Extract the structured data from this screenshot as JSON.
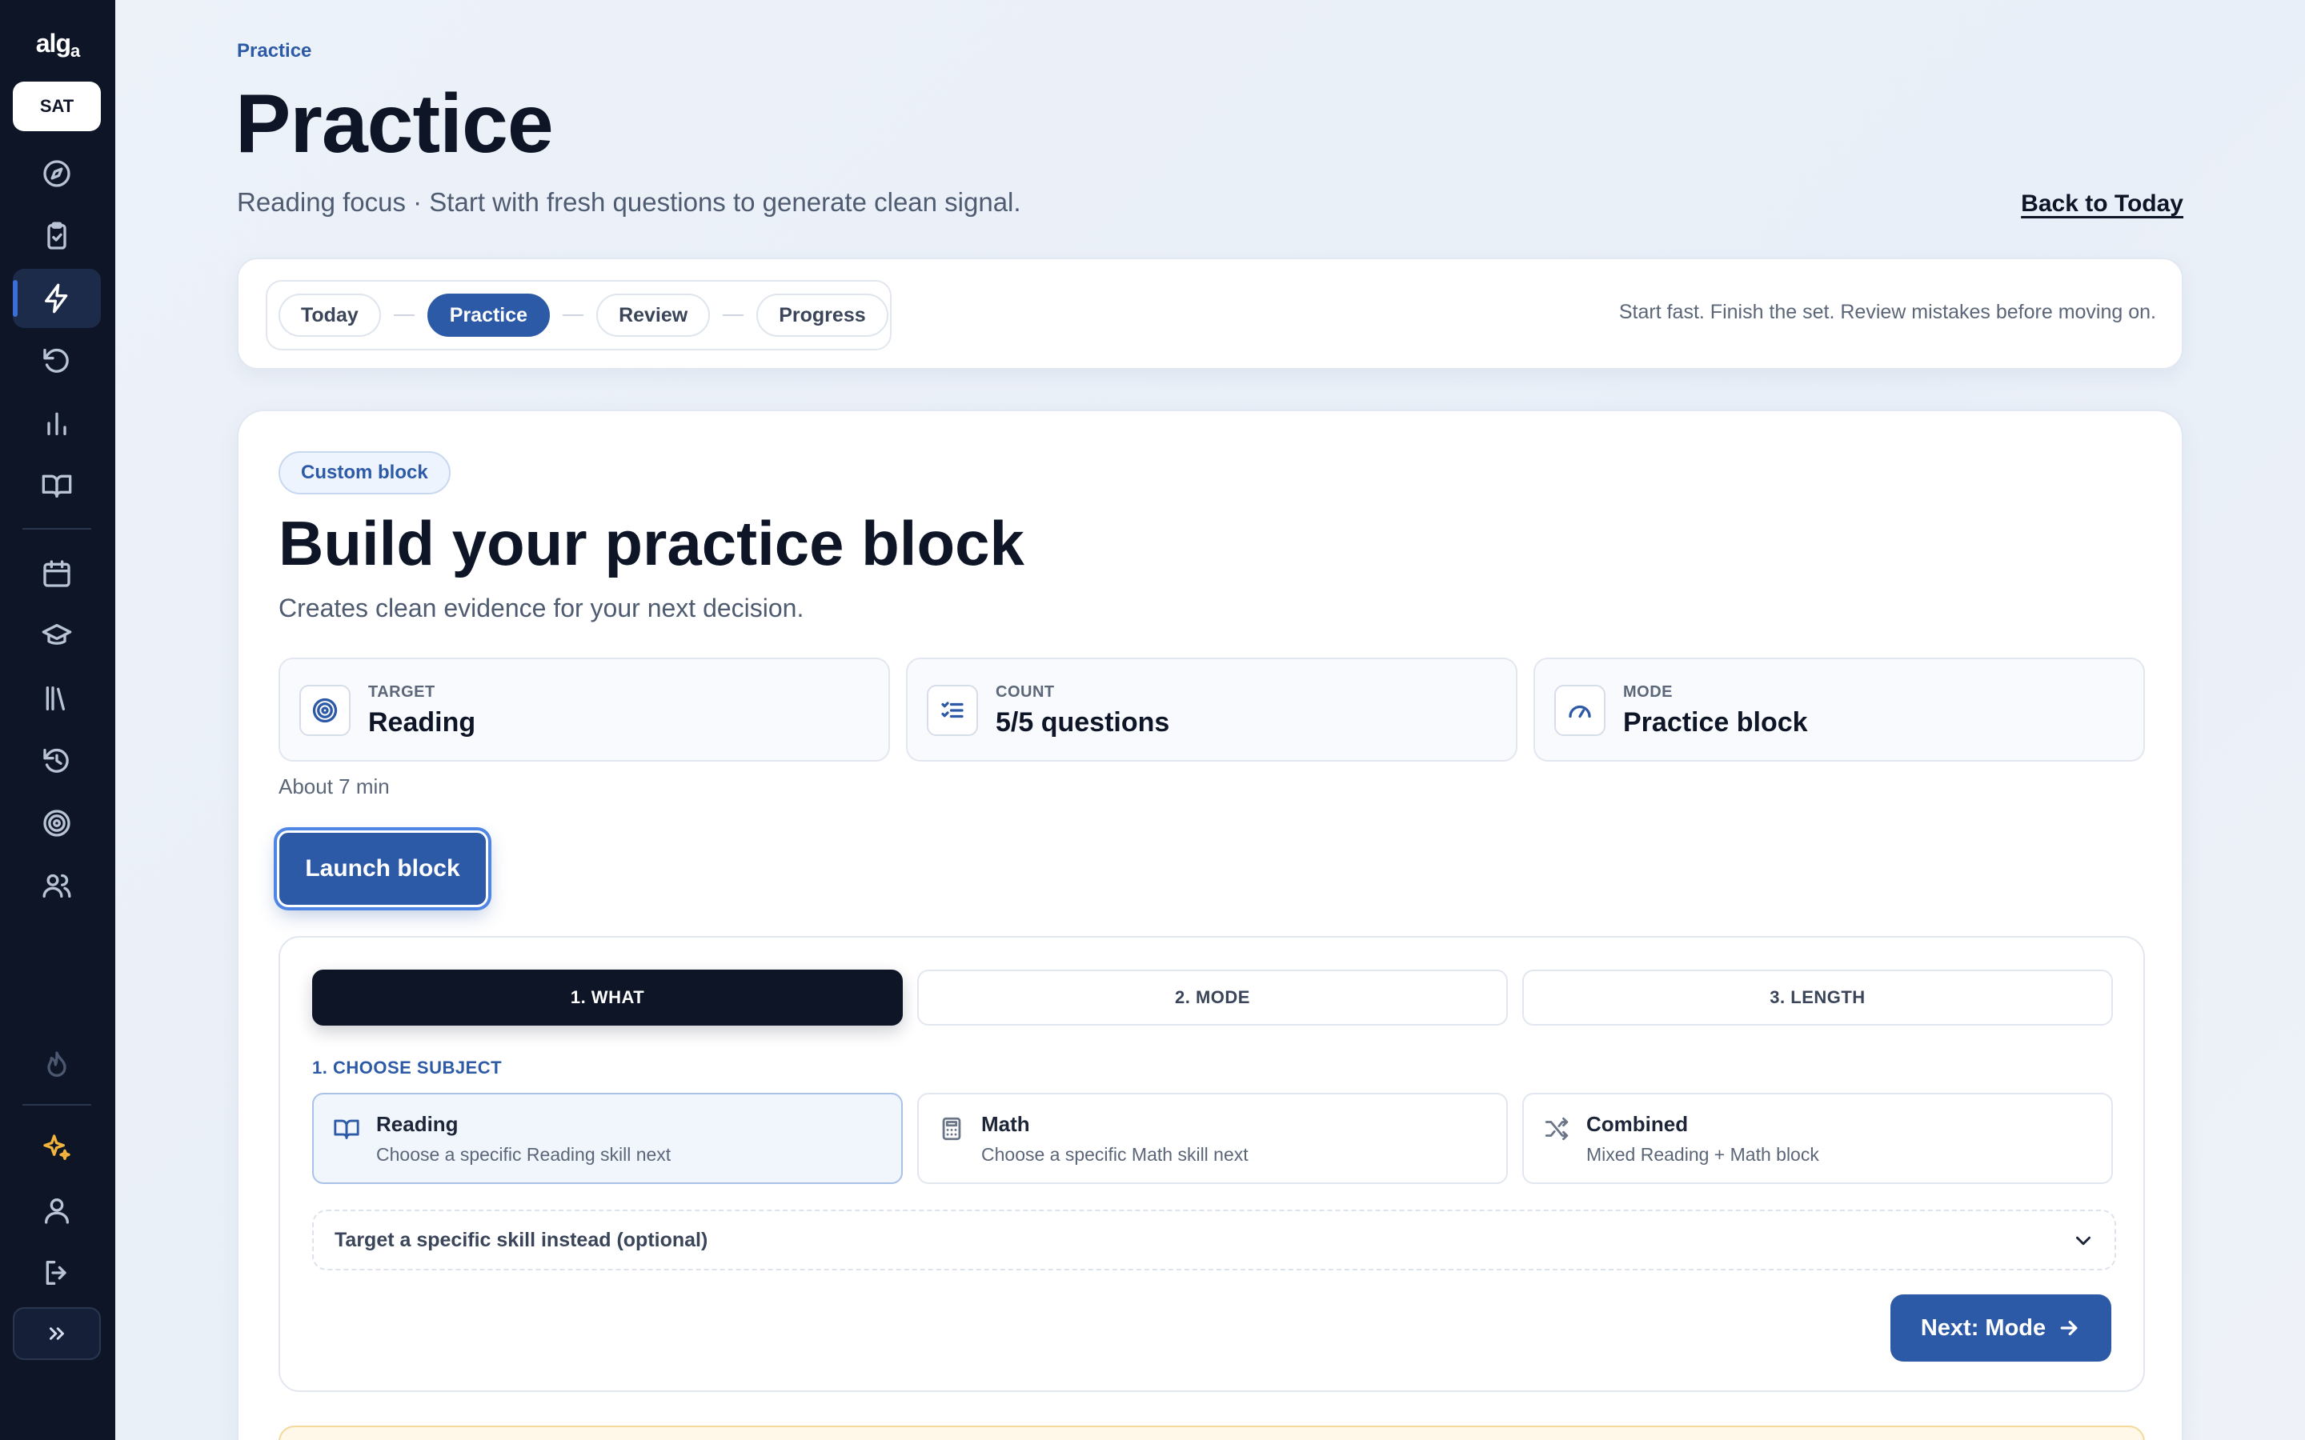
{
  "sidebar": {
    "logo_main": "alg",
    "logo_sub": "a",
    "exam_label": "SAT"
  },
  "header": {
    "breadcrumb": "Practice",
    "title": "Practice",
    "subtitle": "Reading focus · Start with fresh questions to generate clean signal.",
    "back_link": "Back to Today"
  },
  "flow": {
    "steps": [
      "Today",
      "Practice",
      "Review",
      "Progress"
    ],
    "active": "Practice",
    "tip": "Start fast. Finish the set. Review mistakes before moving on."
  },
  "card": {
    "tag": "Custom block",
    "title": "Build your practice block",
    "subtitle": "Creates clean evidence for your next decision.",
    "stats": [
      {
        "label": "TARGET",
        "value": "Reading",
        "icon": "target-icon"
      },
      {
        "label": "COUNT",
        "value": "5/5 questions",
        "icon": "list-check-icon"
      },
      {
        "label": "MODE",
        "value": "Practice block",
        "icon": "gauge-icon"
      }
    ],
    "duration": "About 7 min",
    "launch_label": "Launch block"
  },
  "builder": {
    "tabs": [
      "1. WHAT",
      "2. MODE",
      "3. LENGTH"
    ],
    "active_tab": "1. WHAT",
    "section_label": "1. CHOOSE SUBJECT",
    "subjects": [
      {
        "name": "Reading",
        "desc": "Choose a specific Reading skill next",
        "icon": "book-icon",
        "selected": true
      },
      {
        "name": "Math",
        "desc": "Choose a specific Math skill next",
        "icon": "calculator-icon",
        "selected": false
      },
      {
        "name": "Combined",
        "desc": "Mixed Reading + Math block",
        "icon": "shuffle-icon",
        "selected": false
      }
    ],
    "skill_dropdown": "Target a specific skill instead (optional)",
    "next_label": "Next: Mode"
  },
  "colors": {
    "accent": "#2d5aa6",
    "sidebar_bg": "#0d1526",
    "gold": "#f2b43c"
  }
}
